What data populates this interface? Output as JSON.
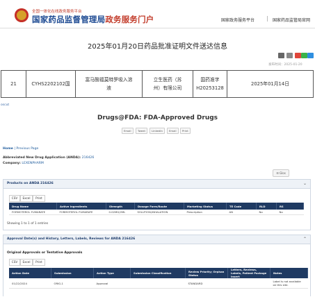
{
  "header": {
    "emblem_icon": "national-emblem-icon",
    "site_subtitle": "全国一体化在线政务服务平台",
    "site_title_blue": "国家药品监督管理局",
    "site_title_red": "政务服务门户",
    "nav": [
      "国家政务服务平台",
      "国家药品监管局官网"
    ]
  },
  "notice": {
    "title": "2025年01月20日药品批准证明文件送达信息",
    "tools": [
      "download-icon",
      "print-icon",
      "weibo-share-icon",
      "wechat-share-icon",
      "qq-share-icon"
    ],
    "published": "发布时间：2025-01-20"
  },
  "approval_row": {
    "index": "21",
    "code": "CYHS2202102国",
    "drug_name_line1": "富马酸福莫特罗吸入溶",
    "drug_name_line2": "液",
    "company_line1": "立生医药（苏",
    "company_line2": "州）有限公司",
    "approval_no_line1": "国药准字",
    "approval_no_line2": "H20253128",
    "date": "2025年01月14日"
  },
  "cut_label": "oscut",
  "fda": {
    "title": "Drugs@FDA: FDA-Approved Drugs",
    "share_buttons": [
      "Email",
      "Tweet",
      "LinkedIn",
      "Email",
      "Print"
    ],
    "breadcrumb_home": "Home",
    "breadcrumb_sep": " | ",
    "breadcrumb_prev": "Previous Page",
    "appl_label": "Abbreviated New Drug Application (ANDA): ",
    "appl_no": "216426",
    "company_label": "Company: ",
    "company": "LEXENPHARM",
    "glossary_btn": "☰ Glos",
    "products_title": "Products on ANDA 216426",
    "export_tabs": [
      "CSV",
      "Excel",
      "Print"
    ],
    "product_columns": [
      "Drug Name",
      "Active Ingredients",
      "Strength",
      "Dosage Form/Route",
      "Marketing Status",
      "TE Code",
      "RLD",
      "RS"
    ],
    "product_rows": [
      [
        "FORMOTEROL FUMARATE",
        "FORMOTEROL FUMARATE",
        "0.02MG/2ML",
        "SOLUTION;INHALATION",
        "Prescription",
        "AN",
        "No",
        "No"
      ]
    ],
    "showing": "Showing 1 to 1 of 1 entries",
    "history_title": "Approval Date(s) and History, Letters, Labels, Reviews for ANDA 216426",
    "original_label": "Original Approvals or Tentative Approvals",
    "history_tabs": [
      "CSV",
      "Excel",
      "Print"
    ],
    "history_columns": [
      "Action Date",
      "Submission",
      "Action Type",
      "Submission Classification",
      "Review Priority; Orphan Status",
      "Letters, Reviews, Labels, Patient Package Insert",
      "Notes"
    ],
    "history_rows": [
      [
        "01/22/2024",
        "ORIG-1",
        "Approval",
        "",
        "STANDARD",
        "",
        "Label is not available on this site."
      ]
    ]
  }
}
